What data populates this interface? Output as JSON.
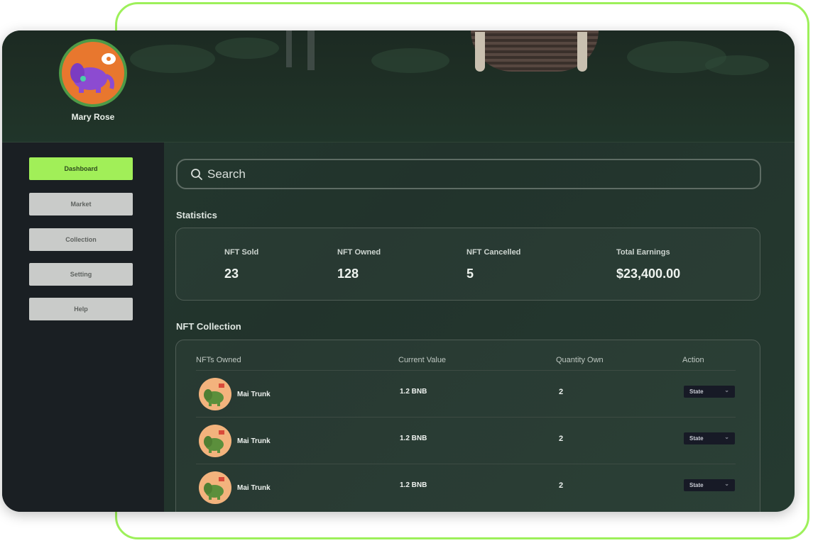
{
  "profile": {
    "name": "Mary Rose"
  },
  "nav": {
    "items": [
      {
        "label": "Dashboard",
        "active": true
      },
      {
        "label": "Market",
        "active": false
      },
      {
        "label": "Collection",
        "active": false
      },
      {
        "label": "Setting",
        "active": false
      },
      {
        "label": "Help",
        "active": false
      }
    ]
  },
  "search": {
    "placeholder": "Search",
    "icon": "search-icon"
  },
  "statistics": {
    "title": "Statistics",
    "items": [
      {
        "label": "NFT Sold",
        "value": "23"
      },
      {
        "label": "NFT Owned",
        "value": "128"
      },
      {
        "label": "NFT Cancelled",
        "value": "5"
      },
      {
        "label": "Total Earnings",
        "value": "$23,400.00"
      }
    ]
  },
  "collection": {
    "title": "NFT Collection",
    "columns": [
      "NFTs Owned",
      "Current Value",
      "Quantity Own",
      "Action"
    ],
    "rows": [
      {
        "name": "Mai Trunk",
        "value": "1.2 BNB",
        "quantity": "2",
        "action": "State"
      },
      {
        "name": "Mai Trunk",
        "value": "1.2 BNB",
        "quantity": "2",
        "action": "State"
      },
      {
        "name": "Mai Trunk",
        "value": "1.2 BNB",
        "quantity": "2",
        "action": "State"
      }
    ]
  },
  "colors": {
    "accent": "#a1ef58",
    "frame": "#9df05a",
    "sidebar": "#1a1f23",
    "avatar_bg": "#e8772e"
  }
}
